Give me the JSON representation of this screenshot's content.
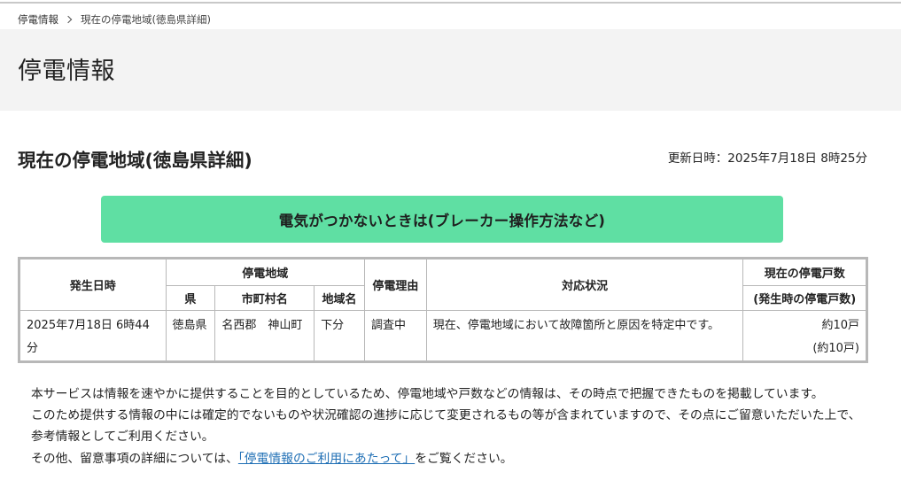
{
  "breadcrumb": {
    "home": "停電情報",
    "current": "現在の停電地域(徳島県詳細)"
  },
  "header": {
    "title": "停電情報"
  },
  "section": {
    "title": "現在の停電地域(徳島県詳細)",
    "updated": "更新日時：2025年7月18日 8時25分"
  },
  "cta": {
    "label": "電気がつかないときは(ブレーカー操作方法など)",
    "color": "#5fdfa3"
  },
  "table": {
    "headers": {
      "date": "発生日時",
      "area_group": "停電地域",
      "prefecture": "県",
      "city": "市町村名",
      "area": "地域名",
      "reason": "停電理由",
      "status": "対応状況",
      "count_line1": "現在の停電戸数",
      "count_line2": "(発生時の停電戸数)"
    },
    "rows": [
      {
        "date": "2025年7月18日 6時44分",
        "prefecture": "徳島県",
        "city": "名西郡　神山町",
        "area": "下分",
        "reason": "調査中",
        "status": "現在、停電地域において故障箇所と原因を特定中です。",
        "count_current": "約10戸",
        "count_initial": "(約10戸)"
      }
    ]
  },
  "notes": {
    "line1": "本サービスは情報を速やかに提供することを目的としているため、停電地域や戸数などの情報は、その時点で把握できたものを掲載しています。",
    "line2": "このため提供する情報の中には確定的でないものや状況確認の進捗に応じて変更されるもの等が含まれていますので、その点にご留意いただいた上で、参考情報としてご利用ください。",
    "line3_prefix": "その他、留意事項の詳細については、",
    "line3_link": "「停電情報のご利用にあたって」",
    "line3_suffix": "をご覧ください。",
    "link_color": "#1f6fb5"
  }
}
